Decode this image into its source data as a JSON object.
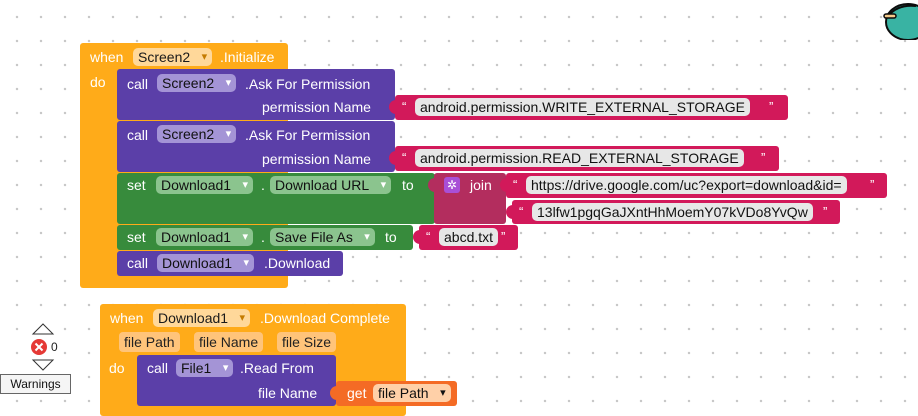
{
  "event1": {
    "when": "when",
    "component": "Screen2",
    "event": ".Initialize",
    "do": "do"
  },
  "calls": [
    {
      "call": "call",
      "component": "Screen2",
      "method": ".Ask For Permission",
      "param": "permission Name",
      "value": "android.permission.WRITE_EXTERNAL_STORAGE"
    },
    {
      "call": "call",
      "component": "Screen2",
      "method": ".Ask For Permission",
      "param": "permission Name",
      "value": "android.permission.READ_EXTERNAL_STORAGE"
    }
  ],
  "set_url": {
    "set": "set",
    "component": "Download1",
    "property": "Download URL",
    "to": "to",
    "join": "join",
    "part1": "https://drive.google.com/uc?export=download&id=",
    "part2": "13lfw1pgqGaJXntHhMoemY07kVDo8YvQw"
  },
  "set_file": {
    "set": "set",
    "component": "Download1",
    "property": "Save File As",
    "to": "to",
    "value": "abcd.txt"
  },
  "call_download": {
    "call": "call",
    "component": "Download1",
    "method": ".Download"
  },
  "event2": {
    "when": "when",
    "component": "Download1",
    "event": ".Download Complete",
    "params": [
      "file Path",
      "file Name",
      "file Size"
    ],
    "do": "do"
  },
  "call_read": {
    "call": "call",
    "component": "File1",
    "method": ".Read From",
    "param": "file Name",
    "get": "get",
    "get_value": "file Path"
  },
  "dot": ".",
  "quote_open": "“",
  "quote_close": "”",
  "warnings": {
    "count": "0",
    "label": "Warnings"
  },
  "colors": {
    "event": "#ffab19",
    "call": "#5b3fa8",
    "set": "#378b3c",
    "text": "#d2195a",
    "get": "#f46b25",
    "error": "#e53935"
  }
}
